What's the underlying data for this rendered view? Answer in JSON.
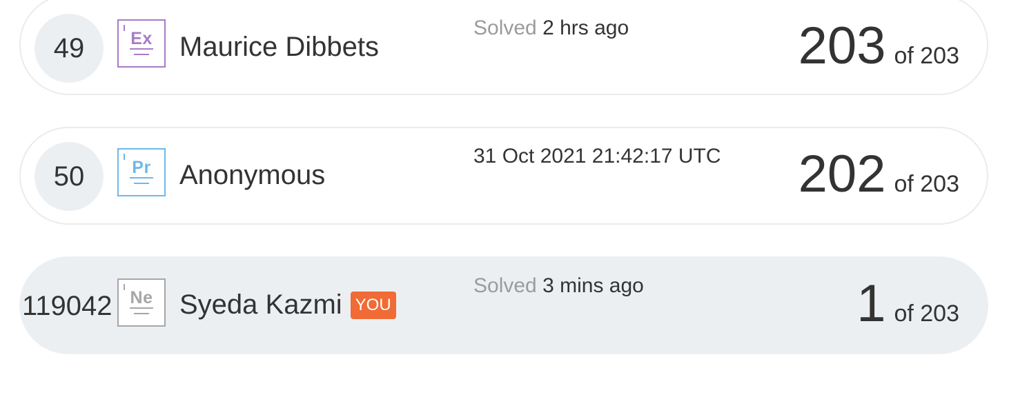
{
  "rows": [
    {
      "rank": "49",
      "badge_symbol": "Ex",
      "badge_color": "#a77bc6",
      "name": "Maurice Dibbets",
      "status_label": "Solved",
      "status_value": "2 hrs ago",
      "score": "203",
      "of_total": "of 203"
    },
    {
      "rank": "50",
      "badge_symbol": "Pr",
      "badge_color": "#6db8ea",
      "name": "Anonymous",
      "status_label": "",
      "status_value": "31 Oct 2021 21:42:17 UTC",
      "score": "202",
      "of_total": "of 203"
    },
    {
      "rank": "119042",
      "badge_symbol": "Ne",
      "badge_color": "#a6a6a6",
      "name": "Syeda Kazmi",
      "you_tag": "YOU",
      "you_tag_color": "#f06b35",
      "status_label": "Solved",
      "status_value": "3 mins ago",
      "score": "1",
      "of_total": "of 203"
    }
  ]
}
